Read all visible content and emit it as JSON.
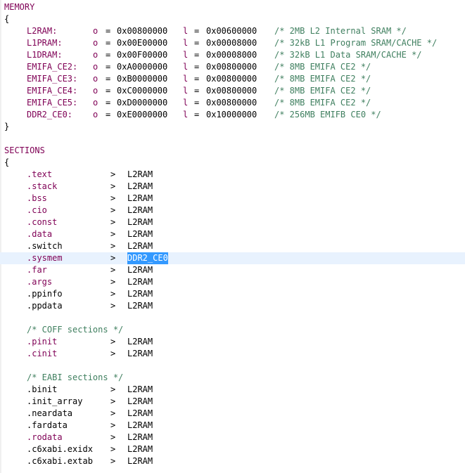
{
  "memory": {
    "header": "MEMORY",
    "open": "{",
    "close": "}",
    "entries": [
      {
        "name": "L2RAM:",
        "o_kw": "o",
        "o_eq": "=",
        "origin": "0x00800000",
        "l_kw": "l",
        "l_eq": "=",
        "length": "0x00600000",
        "comment": "/* 2MB L2 Internal SRAM */"
      },
      {
        "name": "L1PRAM:",
        "o_kw": "o",
        "o_eq": "=",
        "origin": "0x00E00000",
        "l_kw": "l",
        "l_eq": "=",
        "length": "0x00008000",
        "comment": "/* 32kB L1 Program SRAM/CACHE */"
      },
      {
        "name": "L1DRAM:",
        "o_kw": "o",
        "o_eq": "=",
        "origin": "0x00F00000",
        "l_kw": "l",
        "l_eq": "=",
        "length": "0x00008000",
        "comment": "/* 32kB L1 Data SRAM/CACHE */"
      },
      {
        "name": "EMIFA_CE2:",
        "o_kw": "o",
        "o_eq": "=",
        "origin": "0xA0000000",
        "l_kw": "l",
        "l_eq": "=",
        "length": "0x00800000",
        "comment": "/* 8MB EMIFA CE2 */"
      },
      {
        "name": "EMIFA_CE3:",
        "o_kw": "o",
        "o_eq": "=",
        "origin": "0xB0000000",
        "l_kw": "l",
        "l_eq": "=",
        "length": "0x00800000",
        "comment": "/* 8MB EMIFA CE2 */"
      },
      {
        "name": "EMIFA_CE4:",
        "o_kw": "o",
        "o_eq": "=",
        "origin": "0xC0000000",
        "l_kw": "l",
        "l_eq": "=",
        "length": "0x00800000",
        "comment": "/* 8MB EMIFA CE2 */"
      },
      {
        "name": "EMIFA_CE5:",
        "o_kw": "o",
        "o_eq": "=",
        "origin": "0xD0000000",
        "l_kw": "l",
        "l_eq": "=",
        "length": "0x00800000",
        "comment": "/* 8MB EMIFA CE2 */"
      },
      {
        "name": "DDR2_CE0:",
        "o_kw": "o",
        "o_eq": "=",
        "origin": "0xE0000000",
        "l_kw": "l",
        "l_eq": "=",
        "length": "0x10000000",
        "comment": "/* 256MB EMIFB CE0 */"
      }
    ]
  },
  "sections": {
    "header": "SECTIONS",
    "open": "{",
    "arrow": ">",
    "group1": [
      {
        "name": ".text",
        "target": "L2RAM",
        "keyword": true
      },
      {
        "name": ".stack",
        "target": "L2RAM",
        "keyword": true
      },
      {
        "name": ".bss",
        "target": "L2RAM",
        "keyword": true
      },
      {
        "name": ".cio",
        "target": "L2RAM",
        "keyword": true
      },
      {
        "name": ".const",
        "target": "L2RAM",
        "keyword": true
      },
      {
        "name": ".data",
        "target": "L2RAM",
        "keyword": true
      },
      {
        "name": ".switch",
        "target": "L2RAM",
        "keyword": false
      },
      {
        "name": ".sysmem",
        "target": "DDR2_CE0",
        "keyword": true,
        "highlighted": true,
        "selected": true
      },
      {
        "name": ".far",
        "target": "L2RAM",
        "keyword": true
      },
      {
        "name": ".args",
        "target": "L2RAM",
        "keyword": true
      },
      {
        "name": ".ppinfo",
        "target": "L2RAM",
        "keyword": false
      },
      {
        "name": ".ppdata",
        "target": "L2RAM",
        "keyword": false
      }
    ],
    "coff_comment": "/* COFF sections */",
    "group2": [
      {
        "name": ".pinit",
        "target": "L2RAM",
        "keyword": true
      },
      {
        "name": ".cinit",
        "target": "L2RAM",
        "keyword": true
      }
    ],
    "eabi_comment": "/* EABI sections */",
    "group3": [
      {
        "name": ".binit",
        "target": "L2RAM",
        "keyword": false
      },
      {
        "name": ".init_array",
        "target": "L2RAM",
        "keyword": false
      },
      {
        "name": ".neardata",
        "target": "L2RAM",
        "keyword": false
      },
      {
        "name": ".fardata",
        "target": "L2RAM",
        "keyword": false
      },
      {
        "name": ".rodata",
        "target": "L2RAM",
        "keyword": true
      },
      {
        "name": ".c6xabi.exidx",
        "target": "L2RAM",
        "keyword": false
      },
      {
        "name": ".c6xabi.extab",
        "target": "L2RAM",
        "keyword": false
      }
    ]
  },
  "colors": {
    "keyword": "#7f0055",
    "comment": "#3f7f5f",
    "line_highlight": "#e8f2fe",
    "selection": "#3399ff"
  }
}
